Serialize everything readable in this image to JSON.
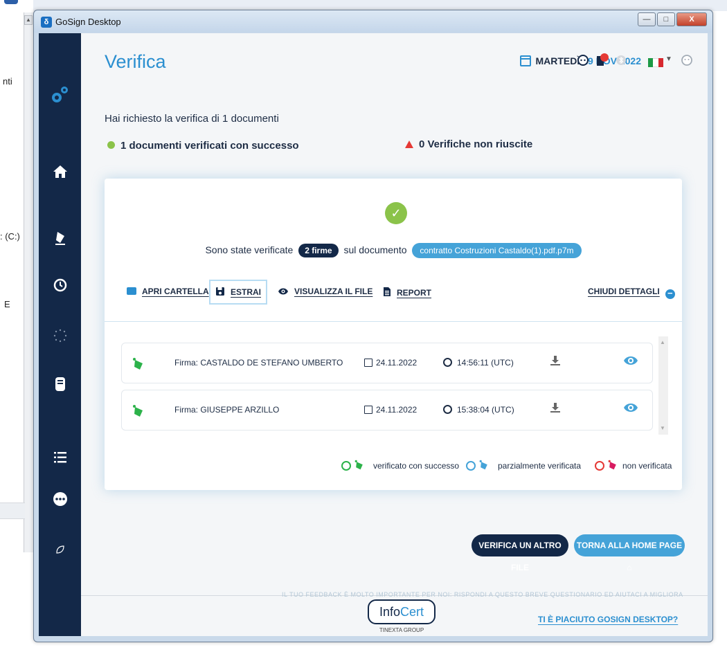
{
  "background": {
    "side_labels": [
      "nti",
      ": (C:)",
      "E"
    ],
    "scroll_up": "▲"
  },
  "window": {
    "title": "GoSign Desktop",
    "icon_glyph": "δ",
    "minimize": "—",
    "maximize": "□",
    "close": "X"
  },
  "header": {
    "title": "Verifica",
    "day": "MARTEDÌ",
    "date": "29 NOV 2022"
  },
  "summary": {
    "request": "Hai richiesto la verifica di 1 documenti",
    "success": "1 documenti verificati con successo",
    "failed": "0 Verifiche non riuscite"
  },
  "card": {
    "verified_prefix": "Sono state verificate",
    "count_pill": "2 firme",
    "verified_mid": "sul documento",
    "file_pill": "contratto Costruzioni Castaldo(1).pdf.p7m",
    "actions": {
      "open_folder": "APRI CARTELLA",
      "extract": "ESTRAI",
      "view_file": "VISUALIZZA IL FILE",
      "report": "REPORT",
      "close_details": "CHIUDI DETTAGLI"
    },
    "signatures": [
      {
        "name": "Firma: CASTALDO DE STEFANO UMBERTO",
        "date": "24.11.2022",
        "time": "14:56:11 (UTC)"
      },
      {
        "name": "Firma: GIUSEPPE ARZILLO",
        "date": "24.11.2022",
        "time": "15:38:04 (UTC)"
      }
    ],
    "legend": {
      "success": "verificato con successo",
      "partial": "parzialmente verificata",
      "failed": "non verificata"
    }
  },
  "buttons": {
    "verify_another": "VERIFICA UN ALTRO FILE",
    "home": "TORNA ALLA HOME PAGE"
  },
  "footer": {
    "feedback": "IL TUO FEEDBACK È MOLTO IMPORTANTE PER NOI: RISPONDI A QUESTO BREVE QUESTIONARIO ED AIUTACI A MIGLIORARE",
    "logo_info": "Info",
    "logo_cert": "Cert",
    "logo_sub": "TINEXTA GROUP",
    "like": "TI È PIACIUTO GOSIGN DESKTOP?"
  },
  "colors": {
    "sidebar": "#132848",
    "accent": "#2b8fd0",
    "success": "#8bc34a",
    "partial": "#45a3d8",
    "error": "#e53935"
  }
}
